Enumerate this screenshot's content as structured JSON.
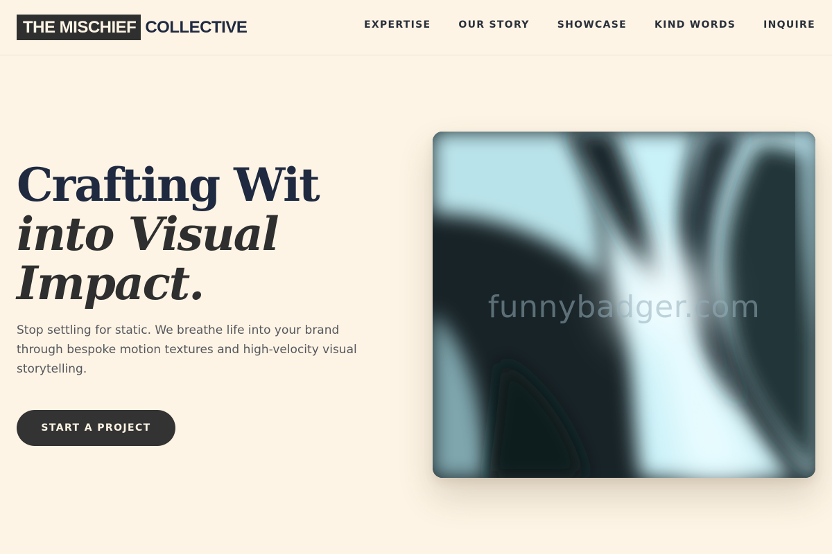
{
  "header": {
    "logo": {
      "boxed": "THE MISCHIEF",
      "plain": "COLLECTIVE"
    },
    "nav": [
      {
        "label": "EXPERTISE"
      },
      {
        "label": "OUR STORY"
      },
      {
        "label": "SHOWCASE"
      },
      {
        "label": "KIND WORDS"
      },
      {
        "label": "INQUIRE"
      }
    ]
  },
  "hero": {
    "title_line1": "Crafting Wit",
    "title_line2": "into Visual",
    "title_line3": "Impact.",
    "subtitle": "Stop settling for static. We breathe life into your brand through bespoke motion textures and high-velocity visual storytelling.",
    "cta_label": "START A PROJECT"
  },
  "visual": {
    "watermark": "funnybadger.com"
  },
  "colors": {
    "background": "#fdf4e5",
    "ink_dark": "#2f2f2f",
    "ink_navy": "#1f2940",
    "cta_background": "#333333",
    "visual_glow": "#d8f4fb"
  }
}
